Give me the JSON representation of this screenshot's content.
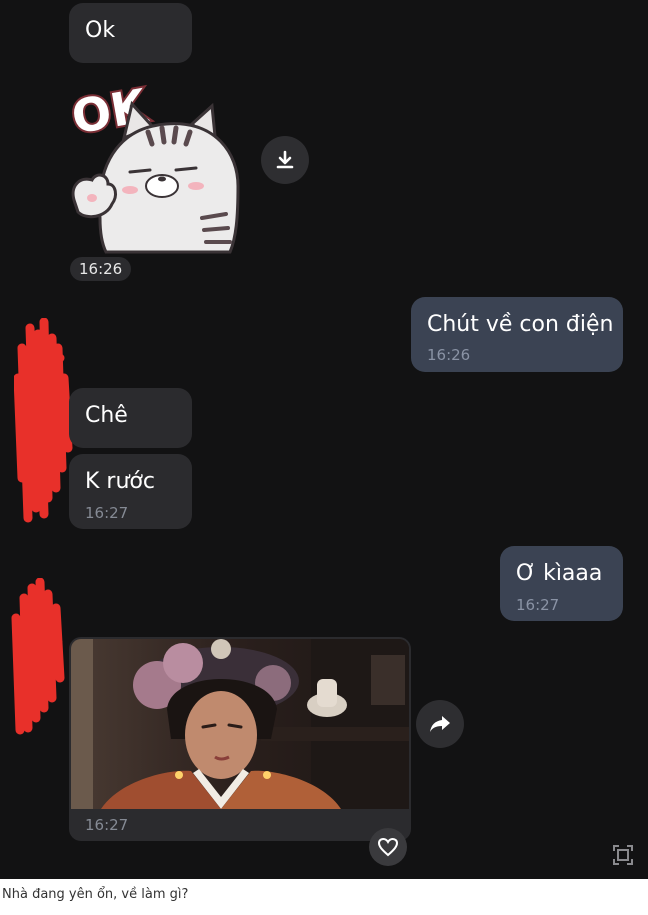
{
  "messages": [
    {
      "text": "Ok",
      "time": ""
    },
    {
      "text": "Chút về con điện",
      "time": "16:26"
    },
    {
      "text": "Chê",
      "time": ""
    },
    {
      "text": "K rước",
      "time": "16:27"
    },
    {
      "text": "Ơ kìaaa",
      "time": "16:27"
    }
  ],
  "sticker": {
    "text": "OK",
    "time": "16:26"
  },
  "media": {
    "time": "16:27"
  },
  "caption": "Nhà đang yên ổn, về làm gì?",
  "icons": {
    "sticker_action": "download-icon",
    "media_action": "share-arrow-icon",
    "reaction": "heart-icon",
    "corner": "expand-icon"
  },
  "colors": {
    "chat_background": "#121213",
    "incoming_bubble": "#2b2b2e",
    "outgoing_bubble": "#3b4353",
    "redaction": "#e8302a"
  }
}
